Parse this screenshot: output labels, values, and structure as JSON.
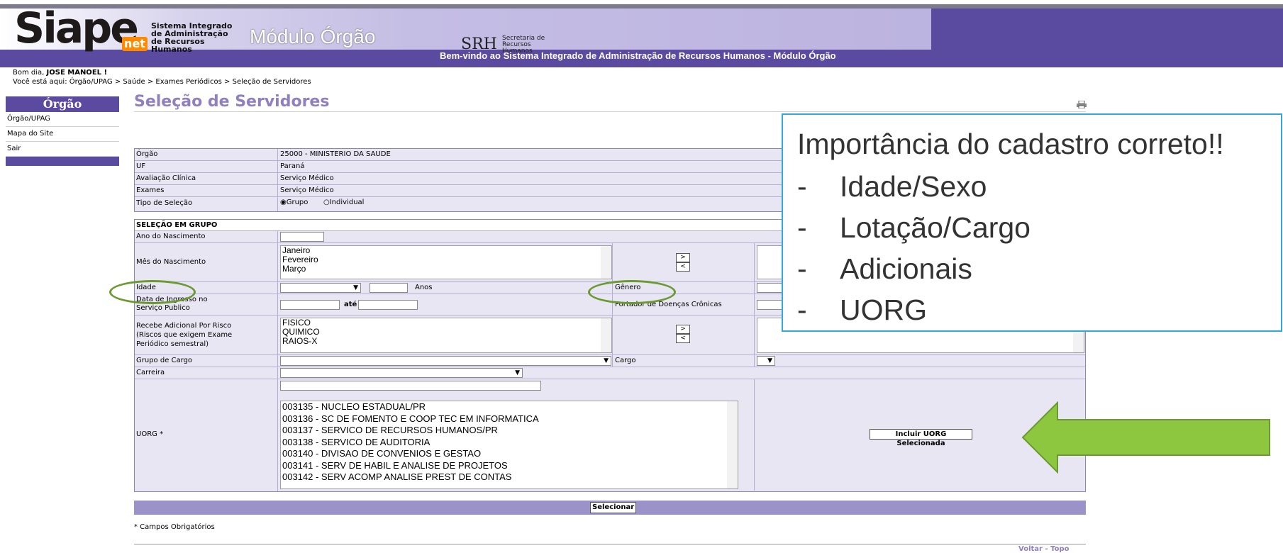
{
  "header": {
    "logo": "Siape",
    "logo_suffix": "net",
    "system_name": "Sistema Integrado de Administração de Recursos Humanos",
    "module": "Módulo Órgão",
    "srh_logo": "SRH",
    "srh_sub": "Secretaria de Recursos Humanos",
    "welcome": "Bem-vindo ao Sistema Integrado de Administração de Recursos Humanos - Módulo Órgão"
  },
  "greeting": {
    "prefix": "Bom dia, ",
    "user": "JOSE MANOEL !"
  },
  "breadcrumb": "Você está aqui:  Órgão/UPAG > Saúde > Exames Periódicos > Seleção de Servidores",
  "sidebar": {
    "title": "Órgão",
    "items": [
      {
        "label": "Órgão/UPAG"
      },
      {
        "label": "Mapa do Site"
      },
      {
        "label": "Sair"
      }
    ]
  },
  "page_title": "Seleção de Servidores",
  "info_table": {
    "rows": [
      {
        "label": "Órgão",
        "value": "25000 - MINISTERIO DA SAUDE"
      },
      {
        "label": "UF",
        "value": "Paraná"
      },
      {
        "label": "Avaliação Clínica",
        "value": "Serviço Médico"
      },
      {
        "label": "Exames",
        "value": "Serviço Médico"
      },
      {
        "label": "Tipo de Seleção",
        "value": ""
      }
    ],
    "radio_group": "Grupo",
    "radio_individual": "Individual",
    "selected": "Grupo"
  },
  "group_form": {
    "section_title": "SELEÇÃO EM GRUPO",
    "birth_year_label": "Ano do Nascimento",
    "birth_month_label": "Mês do Nascimento",
    "months": [
      "Janeiro",
      "Fevereiro",
      "Março"
    ],
    "move_right": ">",
    "move_left": "<",
    "age_label": "Idade",
    "age_unit": "Anos",
    "gender_label": "Gênero",
    "entry_date_label": "Data de Ingresso no Serviço Publico",
    "until_label": "até",
    "chronic_label": "Portador de Doenças Crônicas",
    "risk_label": "Recebe Adicional Por Risco (Riscos que exigem Exame Periódico semestral)",
    "risks": [
      "FISICO",
      "QUIMICO",
      "RAIOS-X"
    ],
    "job_group_label": "Grupo de Cargo",
    "job_label": "Cargo",
    "career_label": "Carreira",
    "uorg_label": "UORG *",
    "uorgs": [
      "003135 - NUCLEO ESTADUAL/PR",
      "003136 - SC DE FOMENTO E COOP TEC EM INFORMATICA",
      "003137 - SERVICO DE RECURSOS HUMANOS/PR",
      "003138 - SERVICO DE AUDITORIA",
      "003140 - DIVISAO DE CONVENIOS E GESTAO",
      "003141 - SERV DE HABIL E ANALISE DE PROJETOS",
      "003142 - SERV ACOMP ANALISE PREST DE CONTAS"
    ],
    "include_uorg_button": "Incluir UORG Selecionada"
  },
  "select_button": "Selecionar",
  "required_note": "* Campos Obrigatórios",
  "bottom_links": {
    "back": "Voltar",
    "sep": " - ",
    "top": "Topo"
  },
  "callout": {
    "title": "Importância do cadastro correto!!",
    "items": [
      "Idade/Sexo",
      "Lotação/Cargo",
      "Adicionais",
      "UORG"
    ]
  },
  "colors": {
    "header_purple": "#5a4aa0",
    "title_purple": "#9080c0",
    "annotation_green": "#6a9a30",
    "arrow_green": "#8dc63f",
    "callout_border": "#32a8d8"
  }
}
